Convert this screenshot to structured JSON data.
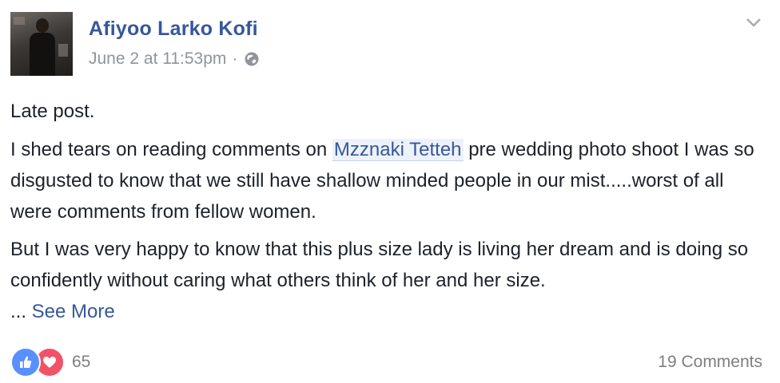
{
  "post": {
    "author": "Afiyoo Larko Kofi",
    "timestamp": "June 2 at 11:53pm",
    "separator": "·",
    "privacy_icon": "globe-icon",
    "options_icon": "chevron-down-icon"
  },
  "content": {
    "line1": "Late post.",
    "p2_before": "I shed tears on reading comments on ",
    "mention": "Mzznaki Tetteh",
    "p2_after": " pre wedding photo shoot I was so disgusted to know that we still have shallow minded people in our mist.....worst of all were comments from fellow women.",
    "p3": "But I was very happy to know that this plus size lady is living her dream and is doing so confidently without caring what others think of her and her size.",
    "ellipsis": "... ",
    "see_more": "See More"
  },
  "footer": {
    "reaction_icons": [
      "like-icon",
      "love-icon"
    ],
    "reaction_count": "65",
    "comments": "19 Comments"
  },
  "colors": {
    "link": "#365899",
    "meta": "#90949c",
    "like": "#5890ff",
    "love": "#f25268"
  }
}
